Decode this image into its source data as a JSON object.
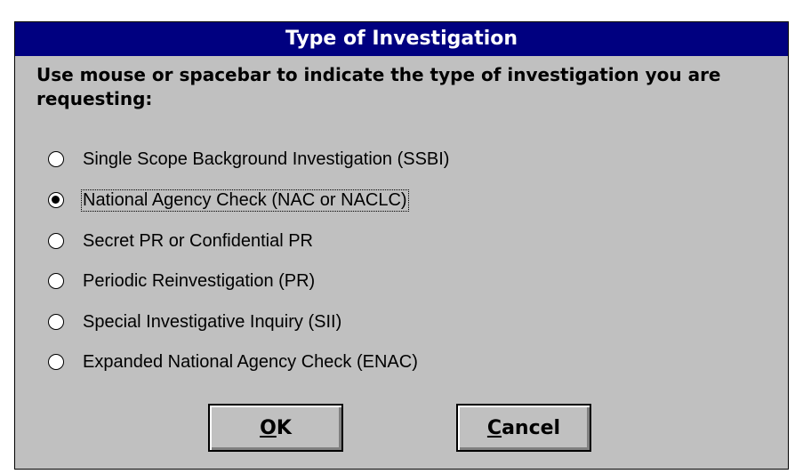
{
  "dialog": {
    "title": "Type of Investigation",
    "instructions": "Use mouse or spacebar to indicate the type of investigation you are requesting:",
    "options": [
      {
        "label": "Single Scope Background Investigation (SSBI)",
        "selected": false
      },
      {
        "label": "National Agency Check (NAC or NACLC)",
        "selected": true
      },
      {
        "label": "Secret PR or Confidential PR",
        "selected": false
      },
      {
        "label": "Periodic Reinvestigation (PR)",
        "selected": false
      },
      {
        "label": "Special Investigative Inquiry (SII)",
        "selected": false
      },
      {
        "label": "Expanded National Agency Check (ENAC)",
        "selected": false
      }
    ],
    "buttons": {
      "ok": {
        "mnemonic": "O",
        "rest": "K"
      },
      "cancel": {
        "mnemonic": "C",
        "rest": "ancel"
      }
    }
  },
  "colors": {
    "title_bar": "#000080",
    "dialog_background": "#c0c0c0"
  }
}
